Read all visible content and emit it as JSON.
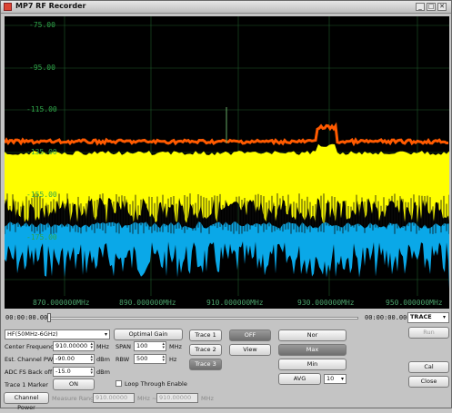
{
  "window": {
    "title": "MP7 RF Recorder",
    "minimize": "_",
    "maximize": "□",
    "close": "✕"
  },
  "plot": {
    "y_ticks": [
      "-75.00",
      "-95.00",
      "-115.00",
      "-135.00",
      "-155.00",
      "-175.00"
    ],
    "x_ticks": [
      "870.000000MHz",
      "890.000000MHz",
      "910.000000MHz",
      "930.000000MHz",
      "950.000000MHz"
    ],
    "colors": {
      "background": "#000000",
      "grid": "#1f5a2a",
      "trace_orange": "#ff5a00",
      "trace_yellow": "#ffff00",
      "trace_blue": "#0aa8e8"
    }
  },
  "timeline": {
    "start": "00:00:00.000",
    "end": "00:00:00.000",
    "mode": "TRACE"
  },
  "controls": {
    "band": "HF(50MHz-6GHz)",
    "center_freq_label": "Center Frequency",
    "center_freq_value": "910.00000",
    "center_freq_unit": "MHz",
    "est_power_label": "Est. Channel PWR",
    "est_power_value": "-90.00",
    "est_power_unit": "dBm",
    "adc_label": "ADC FS Back off",
    "adc_value": "-15.0",
    "adc_unit": "dBm",
    "marker_label": "Trace 1 Marker",
    "marker_btn": "ON",
    "optimal_gain": "Optimal Gain",
    "span_label": "SPAN",
    "span_value": "100",
    "span_unit": "MHz",
    "rbw_label": "RBW",
    "rbw_value": "500",
    "rbw_unit": "Hz",
    "loop_label": "Loop Through Enable",
    "trace1": "Trace 1",
    "trace2": "Trace 2",
    "trace3": "Trace 3",
    "off": "OFF",
    "view": "View",
    "nor": "Nor",
    "max": "Max",
    "min": "Min",
    "avg": "AVG",
    "avg_value": "10",
    "run": "Run",
    "cal": "Cal",
    "close": "Close",
    "channel_power": "Channel Power",
    "measure_range": "Measure Range",
    "range_start": "910.00000",
    "range_mhz1": "MHz ~",
    "range_end": "910.00000",
    "range_mhz2": "MHz"
  }
}
